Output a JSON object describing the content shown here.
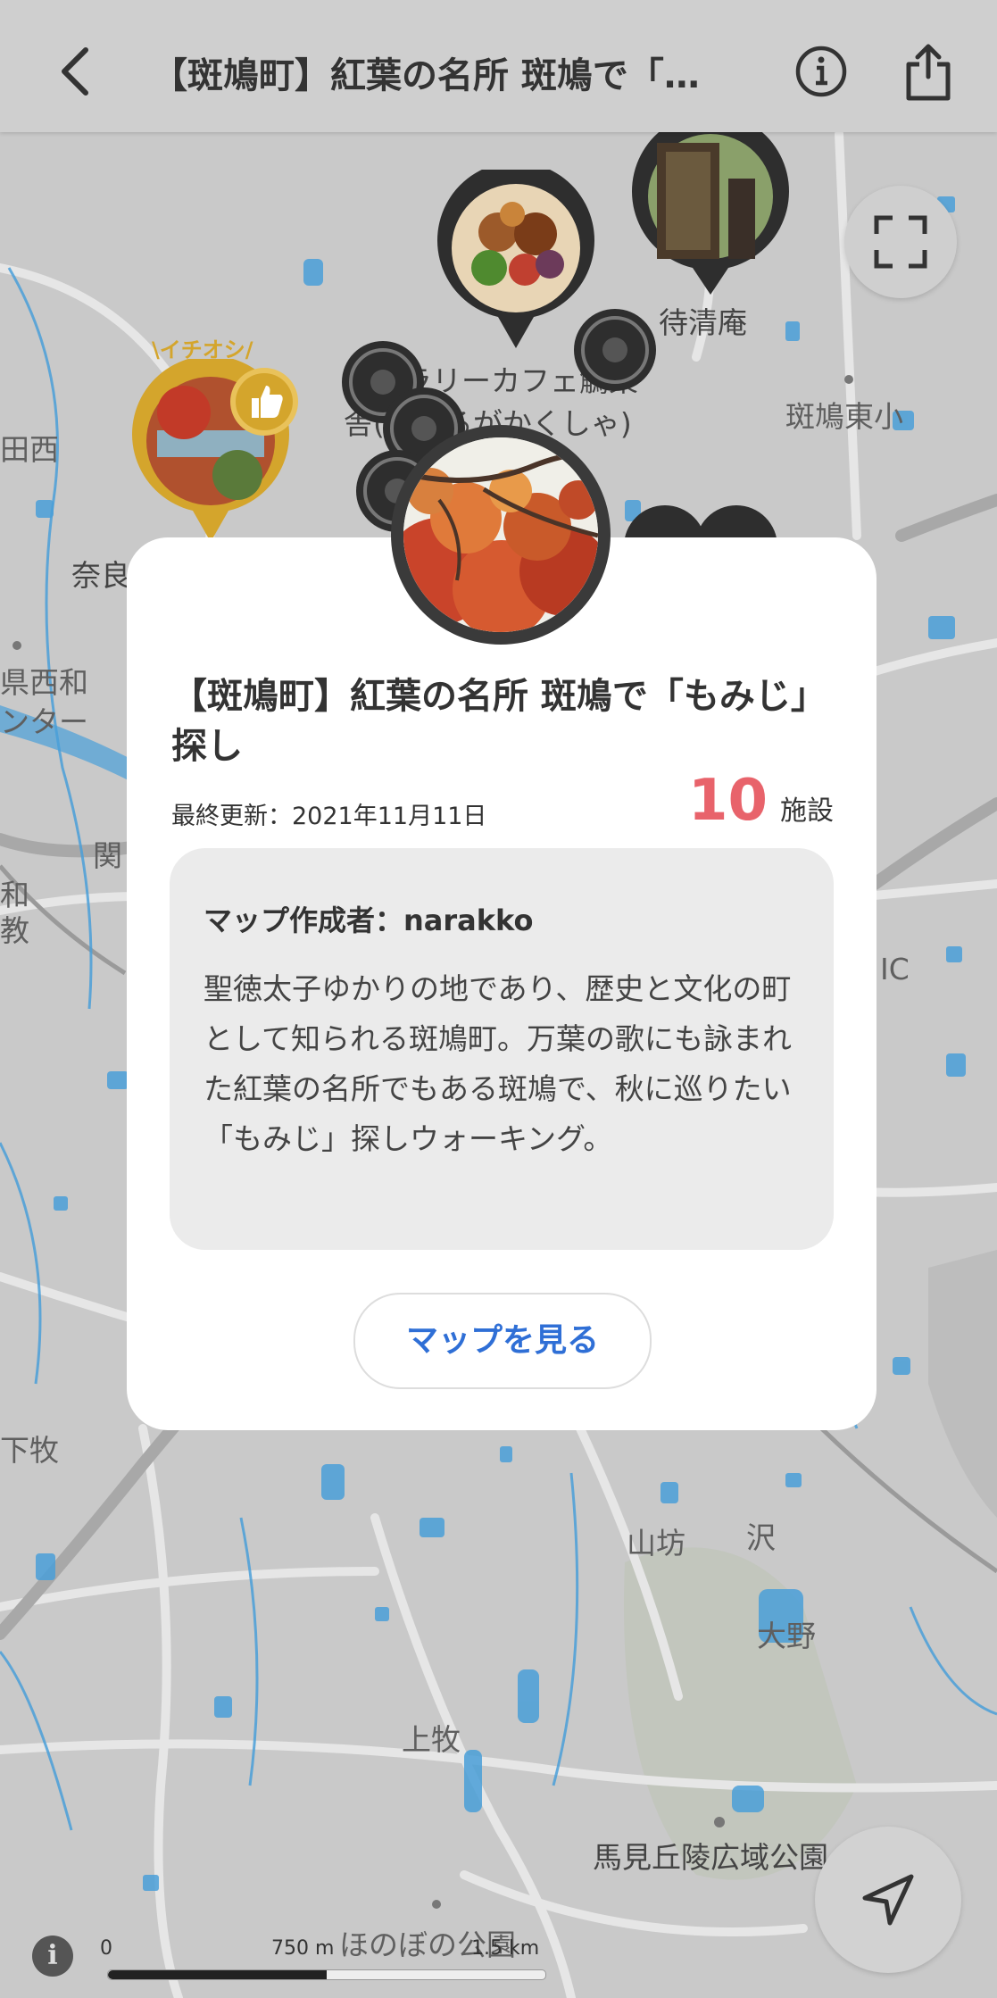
{
  "header": {
    "back_icon": "chevron-left-icon",
    "title": "【斑鳩町】紅葉の名所 斑鳩で「…",
    "info_icon": "info-circle-icon",
    "share_icon": "share-icon"
  },
  "map": {
    "labels": {
      "seiseian": "待清庵",
      "gallery_line1": "ギャラリーカフェ鵤楽",
      "gallery_line2": "舎(いかるがかくしゃ)",
      "ikaruga_higashi": "斑鳩東小",
      "tanishi": "田西",
      "nara": "奈良",
      "ken_nishiwa": "県西和",
      "center": "ンター",
      "seki": "関",
      "wa": "和",
      "kyo": "教",
      "ic": "IC",
      "shimomaki": "下牧",
      "yamabo": "山坊",
      "sawa": "沢",
      "ono": "大野",
      "kamimaki": "上牧",
      "umami": "馬見丘陵広域公園",
      "honobono": "ほのぼの公園"
    },
    "featured_badge": "イチオシ",
    "fullscreen_icon": "fullscreen-icon",
    "locate_icon": "navigation-arrow-icon",
    "scale": {
      "info": "i",
      "t0": "0",
      "t1": "750 m",
      "t2": "1.5 km"
    }
  },
  "popup": {
    "title": "【斑鳩町】紅葉の名所 斑鳩で「もみじ」探し",
    "updated": "最終更新：2021年11月11日",
    "count": "10",
    "count_unit": "施設",
    "author": "マップ作成者：narakko",
    "description": "聖徳太子ゆかりの地であり、歴史と文化の町として知られる斑鳩町。万葉の歌にも詠まれた紅葉の名所でもある斑鳩で、秋に巡りたい「もみじ」探しウォーキング。",
    "view_button": "マップを見る"
  },
  "colors": {
    "accent_blue": "#2f6fd6",
    "count_red": "#e8636b",
    "featured_gold": "#d4a52c",
    "water": "#4a9fd8"
  }
}
